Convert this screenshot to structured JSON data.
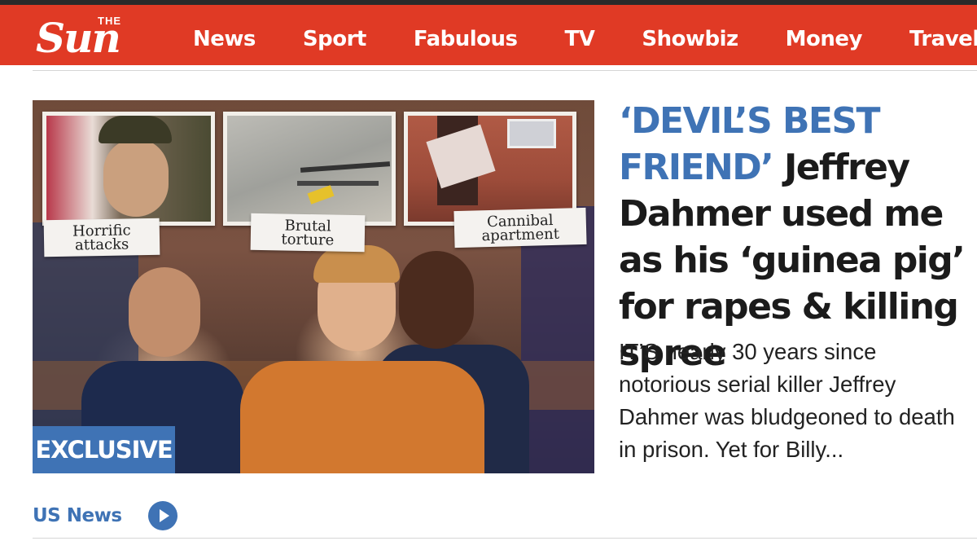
{
  "brand": {
    "the": "THE",
    "name": "Sun"
  },
  "nav": {
    "items": [
      "News",
      "Sport",
      "Fabulous",
      "TV",
      "Showbiz",
      "Money",
      "Travel"
    ]
  },
  "article": {
    "image_captions": [
      "Horrific attacks",
      "Brutal torture",
      "Cannibal apartment"
    ],
    "badge": "EXCLUSIVE",
    "kicker": "‘DEVIL’S BEST FRIEND’",
    "headline": "Jeffrey Dahmer used me as his ‘guinea pig’ for rapes & killing spree",
    "standfirst": "IT’S nearly 30 years since notorious serial killer Jeffrey Dahmer was bludgeoned to death in prison. Yet for Billy...",
    "section": "US News"
  },
  "colors": {
    "brand_red": "#e03a25",
    "accent_blue": "#3f73b5",
    "text": "#1b1b1b"
  },
  "icons": {
    "video": "play-icon"
  }
}
